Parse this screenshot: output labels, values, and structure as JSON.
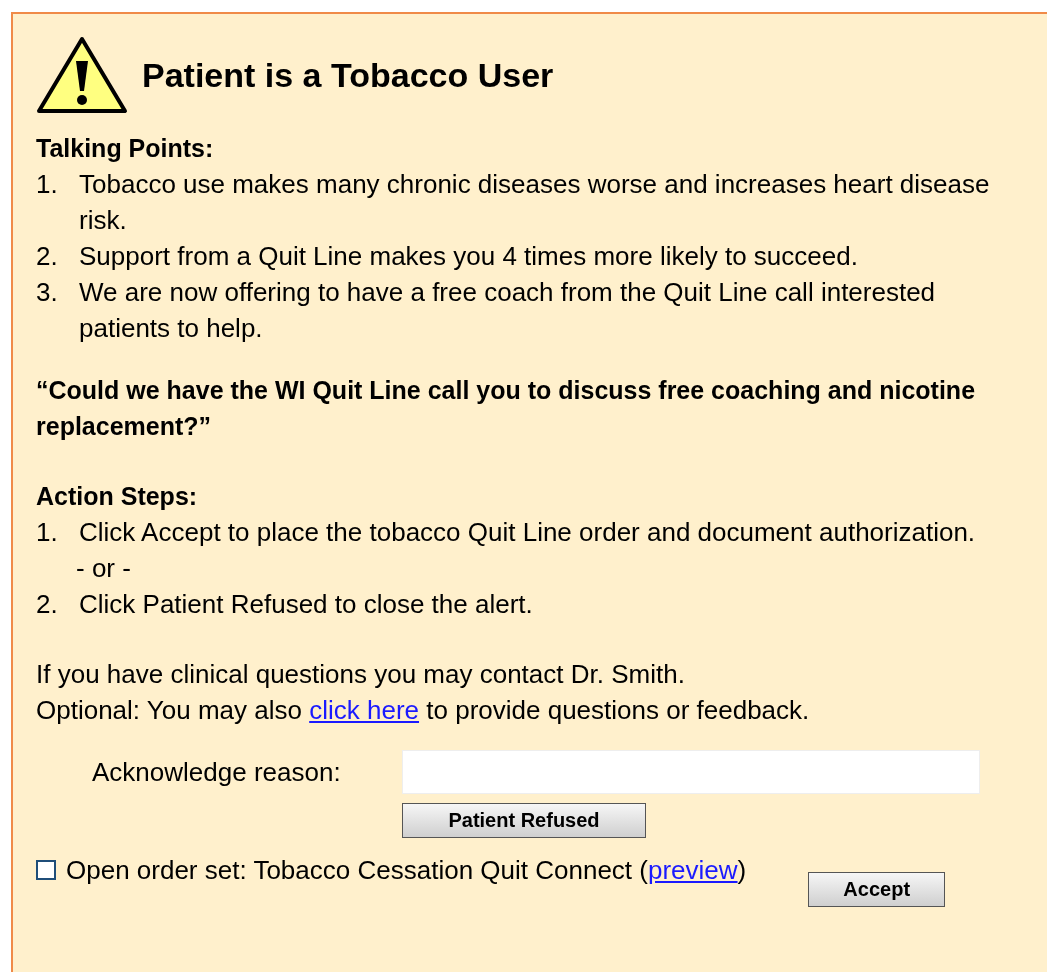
{
  "title": "Patient is a Tobacco User",
  "talking_points": {
    "heading": "Talking Points:",
    "items": [
      {
        "number": "1.",
        "text": "Tobacco use makes many chronic diseases worse and increases heart disease risk."
      },
      {
        "number": "2.",
        "text": "Support from a Quit Line makes you 4 times more likely to succeed."
      },
      {
        "number": "3.",
        "text": "We are now offering to have a free coach from the Quit Line call interested patients to help."
      }
    ]
  },
  "question": "“Could we have the WI Quit Line call you to discuss free coaching and nicotine replacement?”",
  "action_steps": {
    "heading": "Action Steps:",
    "items": [
      {
        "kind": "step",
        "number": "1.",
        "text": "Click Accept to place the tobacco Quit Line order and document authorization."
      },
      {
        "kind": "separator",
        "text": "- or -"
      },
      {
        "kind": "step",
        "number": "2.",
        "text": "Click Patient Refused to close the alert."
      }
    ]
  },
  "contact_note": "If you have clinical questions you may contact Dr. Smith.",
  "optional_note": {
    "before": "Optional: You may also",
    "link": "click here",
    "after": "to provide questions or feedback."
  },
  "acknowledge": {
    "label": "Acknowledge reason:"
  },
  "refuse_button": "Patient Refused",
  "order_set": {
    "checked": false,
    "label": "Open order set: Tobacco Cessation Quit Connect (",
    "link": "preview",
    "after": ")"
  },
  "accept_button": "Accept"
}
